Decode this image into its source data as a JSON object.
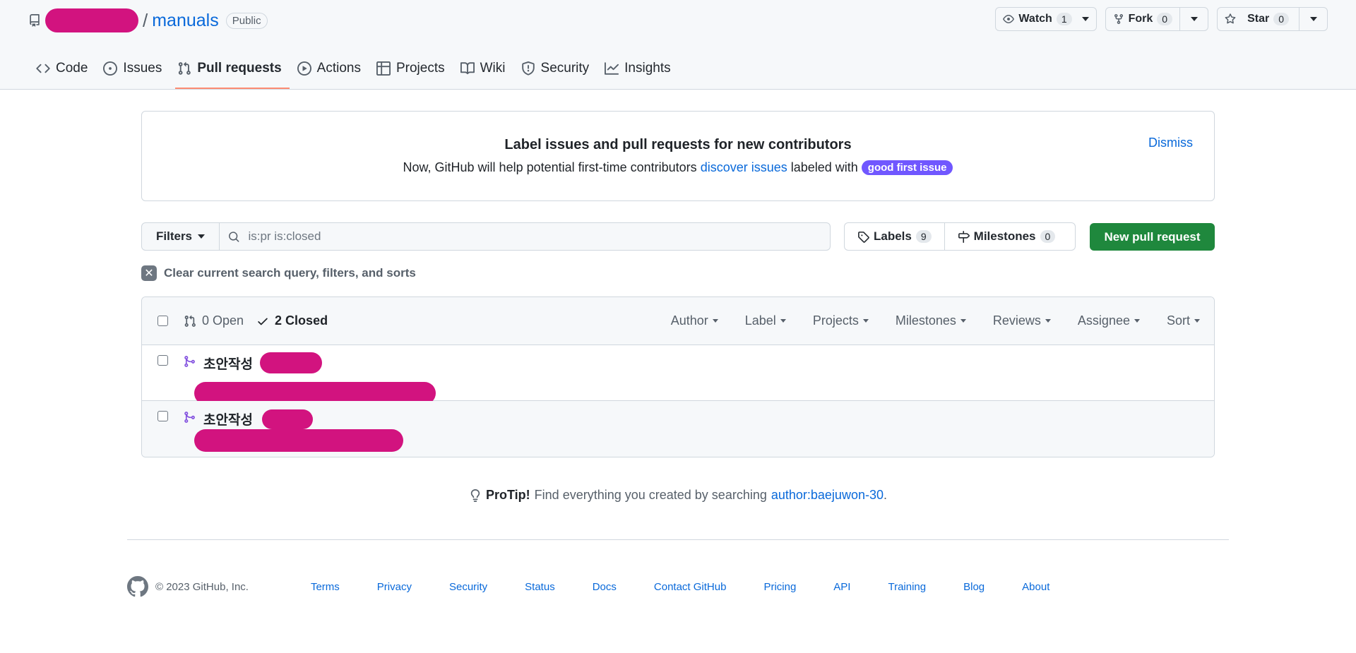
{
  "repo": {
    "owner_redacted": true,
    "separator": "/",
    "name": "manuals",
    "visibility": "Public"
  },
  "repo_actions": {
    "watch": {
      "label": "Watch",
      "count": "1"
    },
    "fork": {
      "label": "Fork",
      "count": "0"
    },
    "star": {
      "label": "Star",
      "count": "0"
    }
  },
  "nav": {
    "items": [
      {
        "label": "Code",
        "icon": "code-icon"
      },
      {
        "label": "Issues",
        "icon": "issue-opened-icon"
      },
      {
        "label": "Pull requests",
        "icon": "git-pull-request-icon",
        "active": true
      },
      {
        "label": "Actions",
        "icon": "play-icon"
      },
      {
        "label": "Projects",
        "icon": "table-icon"
      },
      {
        "label": "Wiki",
        "icon": "book-icon"
      },
      {
        "label": "Security",
        "icon": "shield-icon"
      },
      {
        "label": "Insights",
        "icon": "graph-icon"
      }
    ]
  },
  "banner": {
    "title": "Label issues and pull requests for new contributors",
    "text_before": "Now, GitHub will help potential first-time contributors",
    "link": "discover issues",
    "text_after": "labeled with",
    "label": "good first issue",
    "dismiss": "Dismiss"
  },
  "filters": {
    "filters_label": "Filters",
    "search_value": "is:pr is:closed",
    "labels": {
      "label": "Labels",
      "count": "9"
    },
    "milestones": {
      "label": "Milestones",
      "count": "0"
    },
    "new_pr": "New pull request",
    "clear_query": "Clear current search query, filters, and sorts"
  },
  "pr_list": {
    "open": "0 Open",
    "closed": "2 Closed",
    "sort_menus": [
      "Author",
      "Label",
      "Projects",
      "Milestones",
      "Reviews",
      "Assignee",
      "Sort"
    ],
    "rows": [
      {
        "title": "초안작성"
      },
      {
        "title": "초안작성"
      }
    ]
  },
  "protip": {
    "bold": "ProTip!",
    "text": "Find everything you created by searching",
    "link": "author:baejuwon-30",
    "end": "."
  },
  "footer": {
    "copyright": "© 2023 GitHub, Inc.",
    "links": [
      "Terms",
      "Privacy",
      "Security",
      "Status",
      "Docs",
      "Contact GitHub",
      "Pricing",
      "API",
      "Training",
      "Blog",
      "About"
    ]
  },
  "colors": {
    "accent_link": "#0969da",
    "primary_button": "#1f883d",
    "active_tab_underline": "#fd8c73",
    "good_first_issue": "#7057ff",
    "merged_icon": "#8250df",
    "redaction": "#d2137f"
  }
}
